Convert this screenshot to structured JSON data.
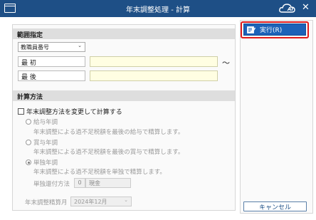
{
  "window": {
    "title": "年末調整処理 - 計算",
    "logo_text": "AI",
    "close_glyph": "✕"
  },
  "range": {
    "section_title": "範囲指定",
    "key_select": "教職員番号",
    "from_label": "最 初",
    "from_value": "",
    "to_label": "最 後",
    "to_value": "",
    "separator": "～"
  },
  "calc": {
    "section_title": "計算方法",
    "change_method_label": "年末調整方法を変更して計算する",
    "change_method_checked": false,
    "options": [
      {
        "title": "給与年調",
        "desc": "年末調整による過不足税額を最後の給与で精算します。",
        "selected": false
      },
      {
        "title": "賞与年調",
        "desc": "年末調整による過不足税額を最後の賞与で精算します。",
        "selected": false
      },
      {
        "title": "単独年調",
        "desc": "年末調整による過不足税額を単独で精算します。",
        "selected": true
      }
    ],
    "refund_method_label": "単独還付方法",
    "refund_code": "0",
    "refund_name": "現金",
    "settle_month_label": "年末調整精算月",
    "settle_month_value": "2024年12月"
  },
  "actions": {
    "execute_label": "実行(R)",
    "cancel_label": "キャンセル"
  },
  "colors": {
    "titlebar": "#1e4f86",
    "execute_button": "#1c62b8",
    "highlight_outline": "#e01b1b",
    "input_yellow": "#fffee2"
  },
  "icons": {
    "window": "window-icon",
    "logo": "cloud-ai-logo",
    "close": "close-icon",
    "execute": "document-edit-icon",
    "dropdown": "chevron-down-icon"
  }
}
